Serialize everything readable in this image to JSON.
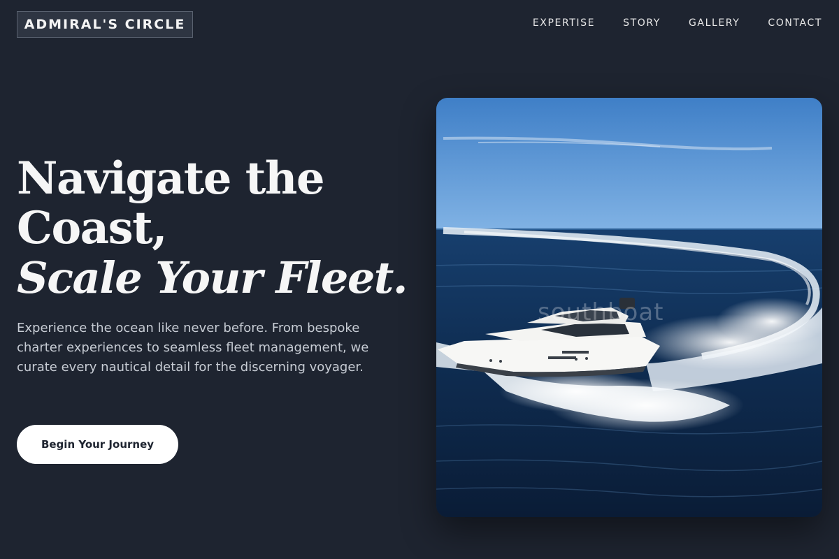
{
  "brand": {
    "name": "ADMIRAL'S CIRCLE"
  },
  "nav": {
    "items": [
      {
        "label": "EXPERTISE"
      },
      {
        "label": "STORY"
      },
      {
        "label": "GALLERY"
      },
      {
        "label": "CONTACT"
      }
    ]
  },
  "hero": {
    "headline_line1": "Navigate the",
    "headline_line2": "Coast,",
    "headline_line3": "Scale Your Fleet.",
    "description": "Experience the ocean like never before. From bespoke charter experiences to seamless fleet management, we curate every nautical detail for the discerning voyager.",
    "cta_label": "Begin Your Journey",
    "image": {
      "watermark": "southboat"
    }
  },
  "colors": {
    "background": "#1e2430",
    "text": "#f6f6f6",
    "muted_text": "#c7ccd4",
    "button_bg": "#ffffff",
    "button_text": "#1e2430"
  }
}
